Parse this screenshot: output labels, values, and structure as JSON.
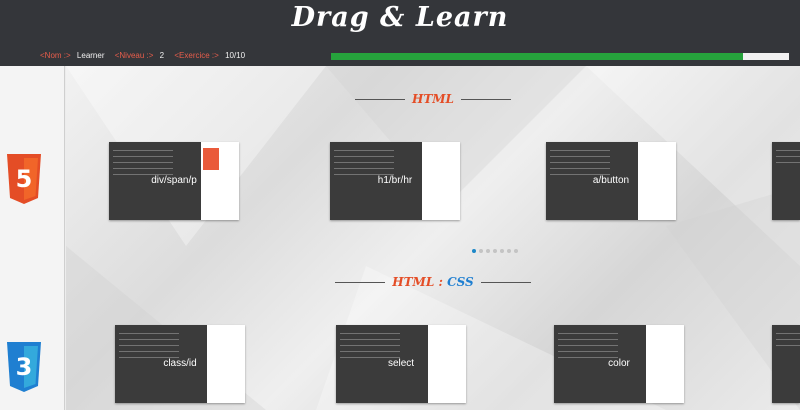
{
  "app": {
    "title": "Drag & Learn"
  },
  "info": {
    "name_tag": "<Nom :>",
    "name_value": "Learner",
    "level_tag": "<Niveau :>",
    "level_value": "2",
    "exercise_tag": "<Exercice :>",
    "exercise_value": "10/10"
  },
  "progress": {
    "fraction": 0.9,
    "color": "#26a33c"
  },
  "sidebar": {
    "badges": [
      {
        "label": "5",
        "icon": "html5-icon",
        "color": "#e44d26"
      },
      {
        "label": "3",
        "icon": "css3-icon",
        "color": "#1f7fd1"
      }
    ]
  },
  "sections": [
    {
      "title_a": "HTML",
      "title_sep": "",
      "title_b": "",
      "cards": [
        {
          "label": "div/span/p"
        },
        {
          "label": "h1/br/hr"
        },
        {
          "label": "a/button"
        }
      ]
    },
    {
      "title_a": "HTML",
      "title_sep": " : ",
      "title_b": "CSS",
      "cards": [
        {
          "label": "class/id"
        },
        {
          "label": "select"
        },
        {
          "label": "color"
        }
      ]
    }
  ],
  "carousel": {
    "dot_count": 7,
    "active_index": 0
  }
}
